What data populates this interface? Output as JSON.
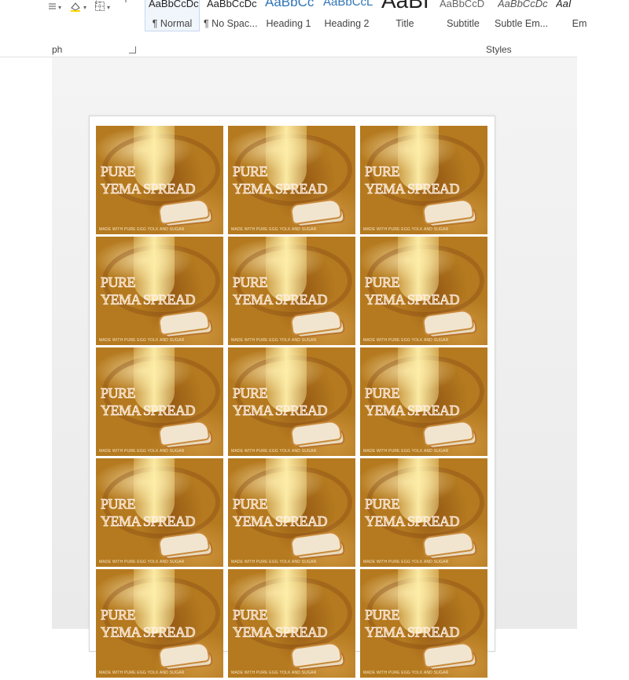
{
  "ribbon": {
    "paragraph_group_label": "ph",
    "styles_group_label": "Styles",
    "styles": [
      {
        "sample": "AaBbCcDc",
        "name": "¶ Normal",
        "selected": true
      },
      {
        "sample": "AaBbCcDc",
        "name": "¶ No Spac...",
        "selected": false
      },
      {
        "sample": "AaBbCc",
        "name": "Heading 1",
        "selected": false
      },
      {
        "sample": "AaBbCcL",
        "name": "Heading 2",
        "selected": false
      },
      {
        "sample": "AaBI",
        "name": "Title",
        "selected": false
      },
      {
        "sample": "AaBbCcD",
        "name": "Subtitle",
        "selected": false
      },
      {
        "sample": "AaBbCcDc",
        "name": "Subtle Em...",
        "selected": false
      },
      {
        "sample": "AaI",
        "name": "Em",
        "selected": false
      }
    ],
    "icons": [
      "bullets-icon",
      "shading-icon",
      "borders-icon",
      "sort-icon",
      "pilcrow-icon"
    ]
  },
  "document": {
    "labels": [
      {
        "line1": "PURE",
        "line2": "YEMA SPREAD",
        "footer": "MADE WITH PURE EGG YOLK AND SUGAR"
      },
      {
        "line1": "PURE",
        "line2": "YEMA SPREAD",
        "footer": "MADE WITH PURE EGG YOLK AND SUGAR"
      },
      {
        "line1": "PURE",
        "line2": "YEMA SPREAD",
        "footer": "MADE WITH PURE EGG YOLK AND SUGAR"
      },
      {
        "line1": "PURE",
        "line2": "YEMA SPREAD",
        "footer": "MADE WITH PURE EGG YOLK AND SUGAR"
      },
      {
        "line1": "PURE",
        "line2": "YEMA SPREAD",
        "footer": "MADE WITH PURE EGG YOLK AND SUGAR"
      },
      {
        "line1": "PURE",
        "line2": "YEMA SPREAD",
        "footer": "MADE WITH PURE EGG YOLK AND SUGAR"
      },
      {
        "line1": "PURE",
        "line2": "YEMA SPREAD",
        "footer": "MADE WITH PURE EGG YOLK AND SUGAR"
      },
      {
        "line1": "PURE",
        "line2": "YEMA SPREAD",
        "footer": "MADE WITH PURE EGG YOLK AND SUGAR"
      },
      {
        "line1": "PURE",
        "line2": "YEMA SPREAD",
        "footer": "MADE WITH PURE EGG YOLK AND SUGAR"
      },
      {
        "line1": "PURE",
        "line2": "YEMA SPREAD",
        "footer": "MADE WITH PURE EGG YOLK AND SUGAR"
      },
      {
        "line1": "PURE",
        "line2": "YEMA SPREAD",
        "footer": "MADE WITH PURE EGG YOLK AND SUGAR"
      },
      {
        "line1": "PURE",
        "line2": "YEMA SPREAD",
        "footer": "MADE WITH PURE EGG YOLK AND SUGAR"
      },
      {
        "line1": "PURE",
        "line2": "YEMA SPREAD",
        "footer": "MADE WITH PURE EGG YOLK AND SUGAR"
      },
      {
        "line1": "PURE",
        "line2": "YEMA SPREAD",
        "footer": "MADE WITH PURE EGG YOLK AND SUGAR"
      },
      {
        "line1": "PURE",
        "line2": "YEMA SPREAD",
        "footer": "MADE WITH PURE EGG YOLK AND SUGAR"
      }
    ],
    "colors": {
      "label_background": "#b57a1f",
      "page": "#ffffff"
    }
  }
}
